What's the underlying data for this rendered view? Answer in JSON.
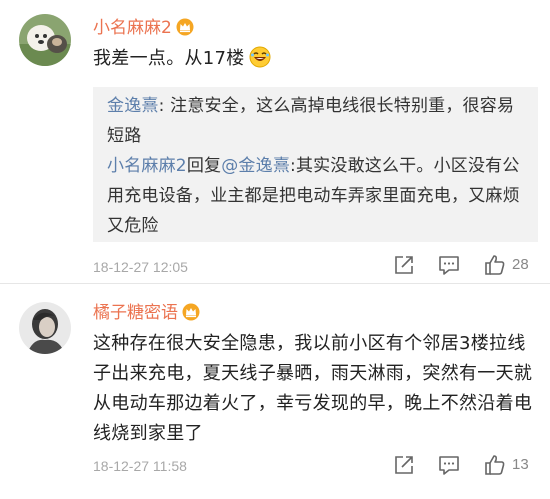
{
  "comments": [
    {
      "username": "小名麻麻2",
      "text": "我差一点。从17楼",
      "replies": [
        {
          "user": "金逸熹",
          "sep": ": ",
          "text": "注意安全，这么高掉电线很长特别重，很容易短路"
        },
        {
          "user": "小名麻麻2",
          "mid": "回复",
          "mention": "@金逸熹",
          "sep": ":",
          "text": "其实没敢这么干。小区没有公用充电设备，业主都是把电动车弄家里面充电，又麻烦又危险"
        }
      ],
      "time": "18-12-27 12:05",
      "likes": "28",
      "emoji": "laughing-emoji"
    },
    {
      "username": "橘子糖密语",
      "text": "这种存在很大安全隐患，我以前小区有个邻居3楼拉线子出来充电，夏天线子暴晒，雨天淋雨，突然有一天就从电动车那边着火了，幸亏发现的早，晚上不然沿着电线烧到家里了",
      "time": "18-12-27 11:58",
      "likes": "13"
    }
  ],
  "colors": {
    "username": "#eb7350",
    "link": "#5d7fab",
    "reply_bg": "#f2f2f2",
    "meta": "#a8a8a8"
  },
  "icons": [
    "vip-crown-icon",
    "share-icon",
    "comment-icon",
    "thumbs-up-icon"
  ]
}
